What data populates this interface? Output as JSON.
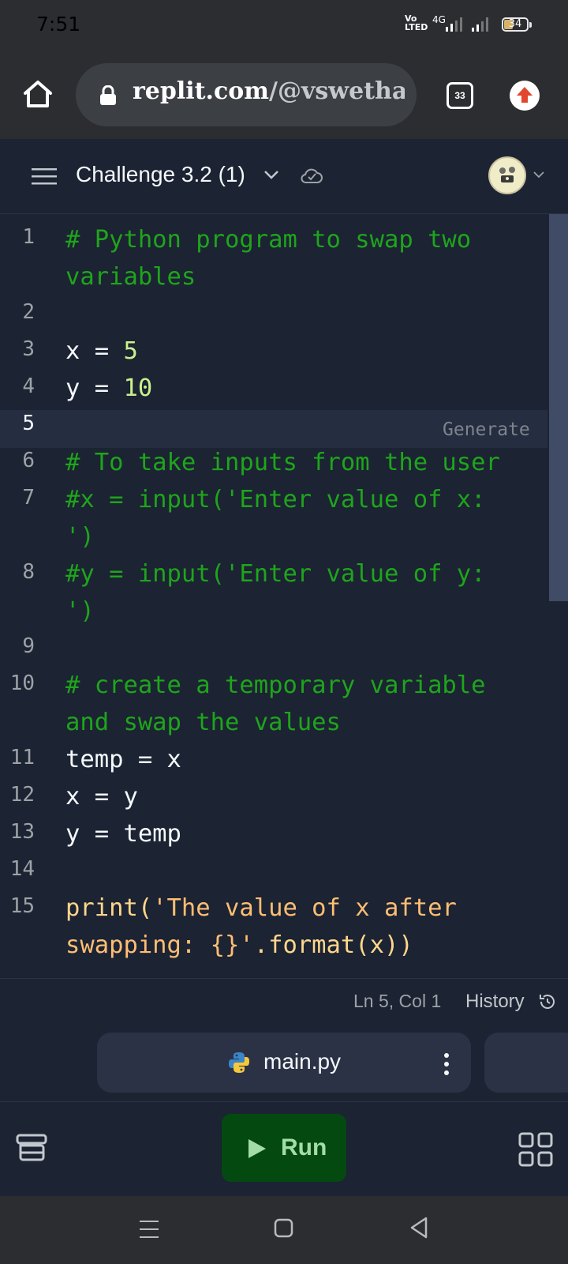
{
  "status_bar": {
    "time": "7:51",
    "network_top": "Vo",
    "network_bottom": "LTED",
    "generation": "4G",
    "battery": "34"
  },
  "browser": {
    "url_domain": "replit.com",
    "url_path": "/@vswethacs",
    "tab_count": "33"
  },
  "app_header": {
    "repl_title": "Challenge 3.2 (1)"
  },
  "editor": {
    "line_numbers": [
      "1",
      "2",
      "3",
      "4",
      "5",
      "6",
      "7",
      "8",
      "9",
      "10",
      "11",
      "12",
      "13",
      "14",
      "15"
    ],
    "active_line": "5",
    "lines": {
      "l1a": "# Python program to swap two",
      "l1b": "variables",
      "l3_var": "x",
      "l3_op": " = ",
      "l3_val": "5",
      "l4_var": "y",
      "l4_op": " = ",
      "l4_val": "10",
      "l6": "# To take inputs from the user",
      "l7a": "#x = input('Enter value of x:",
      "l7b": "')",
      "l8a": "#y = input('Enter value of y:",
      "l8b": "')",
      "l10a": "# create a temporary variable",
      "l10b": "and swap the values",
      "l11": "temp = x",
      "l12": "x = y",
      "l13": "y = temp",
      "l15_fn": "print(",
      "l15_str1": "'The value of x after",
      "l15_str2": "swapping: {}'",
      "l15_rest": ".format(x))"
    },
    "generate_hint": "Generate"
  },
  "footer": {
    "cursor_position": "Ln 5, Col 1",
    "history_label": "History"
  },
  "file_tab": {
    "name": "main.py"
  },
  "toolbar": {
    "run_label": "Run"
  },
  "colors": {
    "background": "#1c2333",
    "comment": "#1ea51b",
    "number": "#c9f18c",
    "string": "#ffbe73",
    "run_button": "#044a10"
  }
}
